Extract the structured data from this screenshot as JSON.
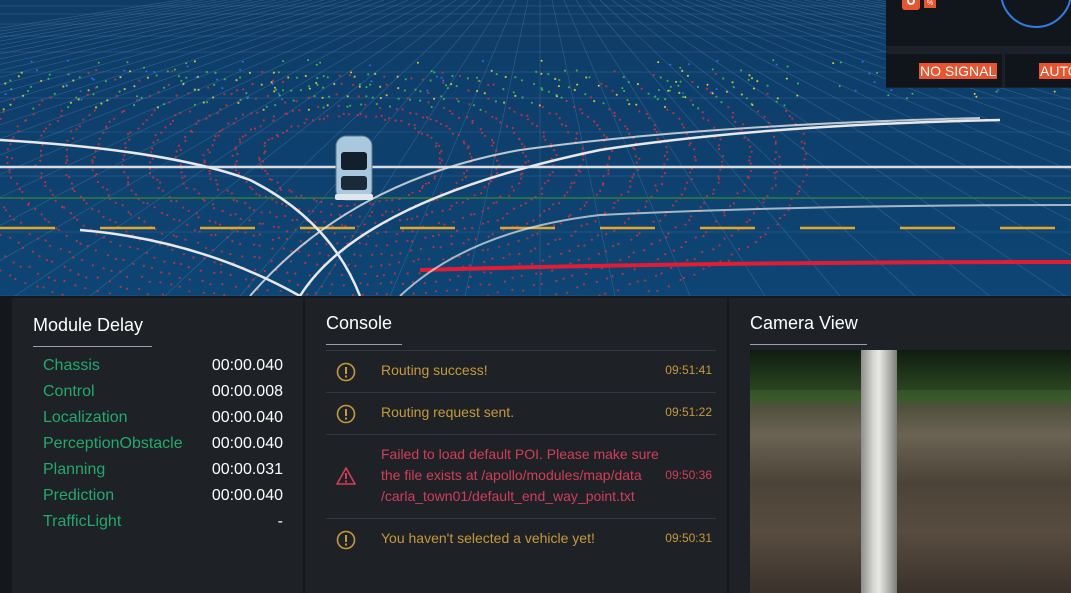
{
  "status": {
    "percent_symbol": "%",
    "signal_label": "NO SIGNAL",
    "mode_label": "AUTO",
    "accent_color": "#e8542d"
  },
  "module_delay": {
    "title": "Module Delay",
    "rows": [
      {
        "name": "Chassis",
        "delay": "00:00.040"
      },
      {
        "name": "Control",
        "delay": "00:00.008"
      },
      {
        "name": "Localization",
        "delay": "00:00.040"
      },
      {
        "name": "PerceptionObstacle",
        "delay": "00:00.040"
      },
      {
        "name": "Planning",
        "delay": "00:00.031"
      },
      {
        "name": "Prediction",
        "delay": "00:00.040"
      },
      {
        "name": "TrafficLight",
        "delay": "-"
      }
    ]
  },
  "console": {
    "title": "Console",
    "messages": [
      {
        "level": "warning",
        "icon": "warning-circle-icon",
        "text": "Routing success!",
        "time": "09:51:41"
      },
      {
        "level": "warning",
        "icon": "warning-circle-icon",
        "text": "Routing request sent.",
        "time": "09:51:22"
      },
      {
        "level": "error",
        "icon": "error-triangle-icon",
        "text_lines": [
          "Failed to load default POI. Please make sure",
          "the file exists at /apollo/modules/map/data",
          "/carla_town01/default_end_way_point.txt"
        ],
        "time": "09:50:36"
      },
      {
        "level": "warning",
        "icon": "warning-circle-icon",
        "text": "You haven't selected a vehicle yet!",
        "time": "09:50:31"
      }
    ],
    "warning_color": "#c59a3c",
    "error_color": "#d23e5a"
  },
  "camera": {
    "title": "Camera View"
  }
}
